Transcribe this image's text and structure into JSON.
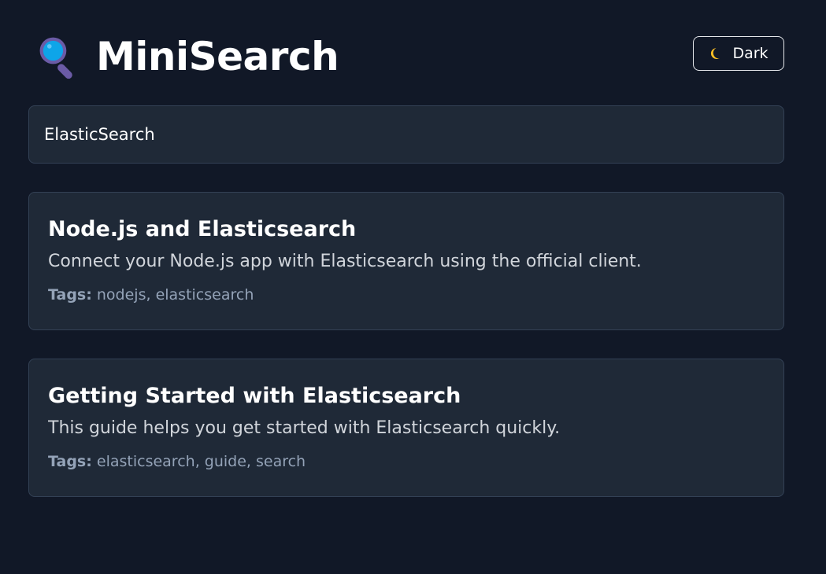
{
  "header": {
    "title": "MiniSearch",
    "logo_icon": "magnifying-glass-icon",
    "theme_toggle": {
      "label": "Dark",
      "icon": "moon-icon"
    }
  },
  "search": {
    "value": "ElasticSearch"
  },
  "results": [
    {
      "title": "Node.js and Elasticsearch",
      "description": "Connect your Node.js app with Elasticsearch using the official client.",
      "tags_label": "Tags:",
      "tags": "nodejs, elasticsearch"
    },
    {
      "title": "Getting Started with Elasticsearch",
      "description": "This guide helps you get started with Elasticsearch quickly.",
      "tags_label": "Tags:",
      "tags": "elasticsearch, guide, search"
    }
  ],
  "colors": {
    "background": "#111827",
    "card": "#1f2937",
    "border": "#334155",
    "text": "#ffffff",
    "muted": "#94a3b8",
    "logo": "#0ea5e9",
    "logo_handle": "#6b5ba6"
  }
}
